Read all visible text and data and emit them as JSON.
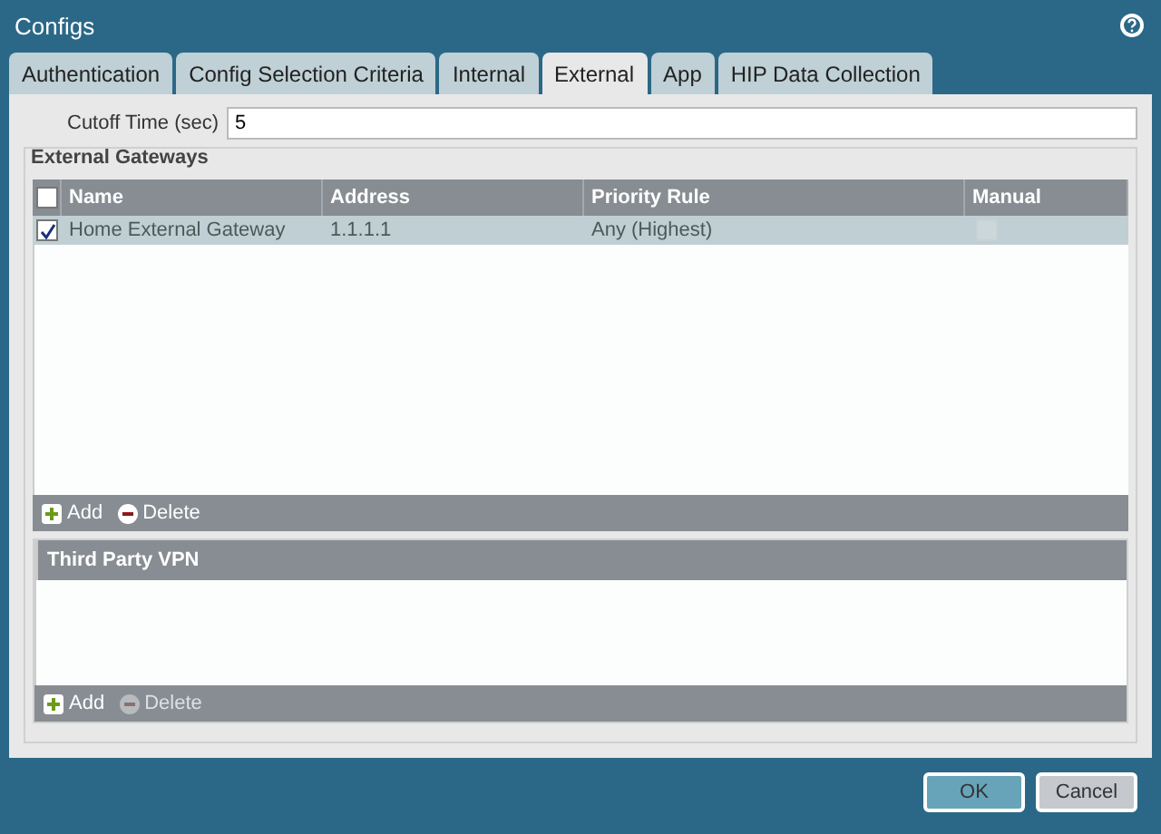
{
  "window": {
    "title": "Configs"
  },
  "tabs": [
    {
      "label": "Authentication",
      "selected": false
    },
    {
      "label": "Config Selection Criteria",
      "selected": false
    },
    {
      "label": "Internal",
      "selected": false
    },
    {
      "label": "External",
      "selected": true
    },
    {
      "label": "App",
      "selected": false
    },
    {
      "label": "HIP Data Collection",
      "selected": false
    }
  ],
  "cutoff": {
    "label": "Cutoff Time (sec)",
    "value": "5"
  },
  "external_gateways": {
    "title": "External Gateways",
    "select_all_checked": false,
    "columns": [
      "Name",
      "Address",
      "Priority Rule",
      "Manual"
    ],
    "rows": [
      {
        "checked": true,
        "selected": true,
        "name": "Home External Gateway",
        "address": "1.1.1.1",
        "priority": "Any (Highest)",
        "manual": false
      }
    ],
    "actions": [
      {
        "label": "Add",
        "kind": "add",
        "disabled": false
      },
      {
        "label": "Delete",
        "kind": "delete",
        "disabled": false
      }
    ]
  },
  "third_party_vpn": {
    "title": "Third Party VPN",
    "actions": [
      {
        "label": "Add",
        "kind": "add",
        "disabled": false
      },
      {
        "label": "Delete",
        "kind": "delete",
        "disabled": true
      }
    ]
  },
  "buttons": [
    {
      "label": "OK",
      "kind": "primary"
    },
    {
      "label": "Cancel",
      "kind": "secondary"
    }
  ]
}
